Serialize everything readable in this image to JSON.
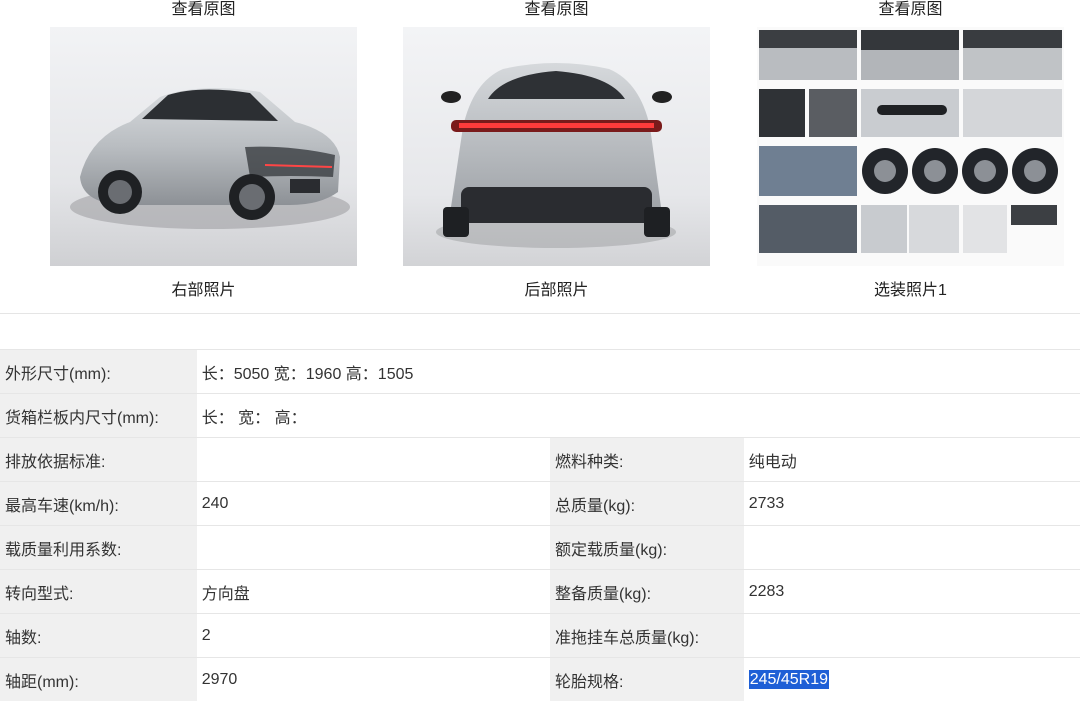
{
  "photos": [
    {
      "view_label": "查看原图",
      "caption": "右部照片",
      "icon": "car-front-side-photo"
    },
    {
      "view_label": "查看原图",
      "caption": "后部照片",
      "icon": "car-rear-photo"
    },
    {
      "view_label": "查看原图",
      "caption": "选装照片1",
      "icon": "car-options-collage-photo"
    }
  ],
  "params": {
    "size_label": "外形尺寸(mm):",
    "size_value": "长：5050 宽：1960 高：1505",
    "cargo_label": "货箱栏板内尺寸(mm):",
    "cargo_value": "长：  宽：  高：",
    "rows": [
      {
        "l1": "排放依据标准:",
        "v1": "",
        "l2": "燃料种类:",
        "v2": "纯电动"
      },
      {
        "l1": "最高车速(km/h):",
        "v1": "240",
        "l2": "总质量(kg):",
        "v2": "2733"
      },
      {
        "l1": "载质量利用系数:",
        "v1": "",
        "l2": "额定载质量(kg):",
        "v2": ""
      },
      {
        "l1": "转向型式:",
        "v1": "方向盘",
        "l2": "整备质量(kg):",
        "v2": "2283"
      },
      {
        "l1": "轴数:",
        "v1": "2",
        "l2": "准拖挂车总质量(kg):",
        "v2": ""
      },
      {
        "l1": "轴距(mm):",
        "v1": "2970",
        "l2": "轮胎规格:",
        "v2": "245/45R19"
      }
    ]
  }
}
